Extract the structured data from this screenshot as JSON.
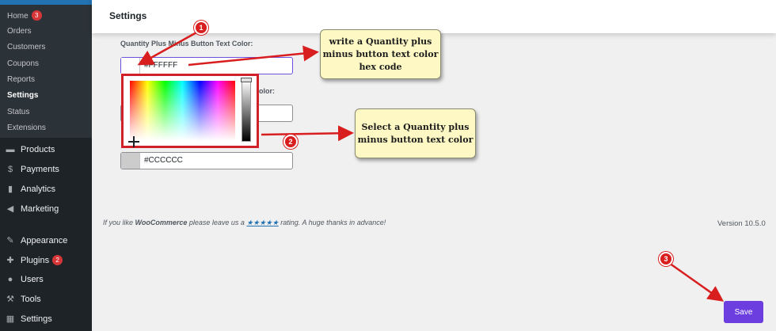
{
  "sidebar": {
    "submenu": [
      {
        "label": "Home",
        "badge": "3"
      },
      {
        "label": "Orders"
      },
      {
        "label": "Customers"
      },
      {
        "label": "Coupons"
      },
      {
        "label": "Reports"
      },
      {
        "label": "Settings",
        "current": true
      },
      {
        "label": "Status"
      },
      {
        "label": "Extensions"
      }
    ],
    "menu": [
      {
        "label": "Products",
        "icon": "products-icon"
      },
      {
        "label": "Payments",
        "icon": "payments-icon"
      },
      {
        "label": "Analytics",
        "icon": "analytics-icon"
      },
      {
        "label": "Marketing",
        "icon": "marketing-icon"
      },
      {
        "label": "Appearance",
        "icon": "appearance-icon"
      },
      {
        "label": "Plugins",
        "icon": "plugins-icon",
        "badge": "2"
      },
      {
        "label": "Users",
        "icon": "users-icon"
      },
      {
        "label": "Tools",
        "icon": "tools-icon"
      },
      {
        "label": "Settings",
        "icon": "settings-icon"
      }
    ]
  },
  "header": {
    "title": "Settings"
  },
  "form": {
    "text_color_label": "Quantity Plus Minus Button Text Color:",
    "text_color_value": "#FFFFFF",
    "partial_label": "olor:",
    "third_value": "#CCCCCC"
  },
  "callouts": {
    "first": "write a Quantity plus minus button text color hex code",
    "second": "Select a Quantity plus minus button text color"
  },
  "steps": [
    "1",
    "2",
    "3"
  ],
  "footer": {
    "prefix": "If you like ",
    "brand": "WooCommerce",
    "middle": " please leave us a ",
    "stars": "★★★★★",
    "suffix": " rating. A huge thanks in advance!",
    "version": "Version 10.5.0"
  },
  "save_label": "Save",
  "colors": {
    "accent": "#6c3ee0",
    "annotation_red": "#d81e1e",
    "callout_bg": "#fdf8c4",
    "sidebar_bg": "#1d2327"
  }
}
